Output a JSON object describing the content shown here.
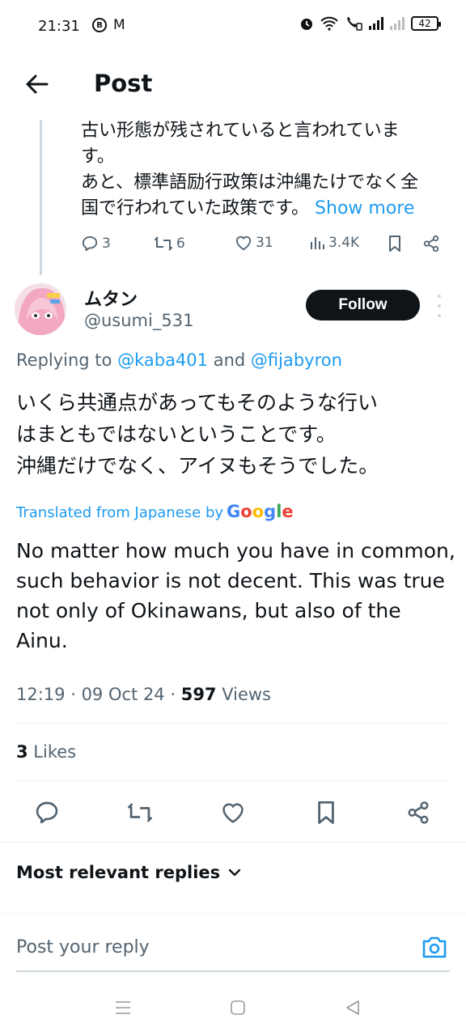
{
  "status_bar": {
    "time": "21:31",
    "left_icons": [
      "b-circle-icon",
      "gmail-icon"
    ],
    "right_icons": [
      "alarm-icon",
      "wifi-icon",
      "volte-call-icon",
      "signal-icon",
      "signal-weak-icon"
    ],
    "battery": "42"
  },
  "header": {
    "title": "Post"
  },
  "parent": {
    "text_line1": "古い形態が残されていると言われていま",
    "text_line2": "す。",
    "text_line3": "あと、標準語励行政策は沖縄たけでなく全",
    "text_line4": "国で行われていた政策です。",
    "show_more": "Show more",
    "replies": "3",
    "reposts": "6",
    "likes": "31",
    "views": "3.4K"
  },
  "reply": {
    "name": "ムタン",
    "handle": "@usumi_531",
    "follow_label": "Follow",
    "replying_prefix": "Replying to ",
    "replying_user1": "@kaba401",
    "replying_and": " and ",
    "replying_user2": "@fijabyron",
    "text_line1": "いくら共通点があってもそのような行い",
    "text_line2": "はまともではないということです。",
    "text_line3": "沖縄だけでなく、アイヌもそうでした。",
    "translated_label": "Translated from Japanese by",
    "translated_provider": "Google",
    "translation": "No matter how much you have in common, such behavior is not decent. This was true not only of Okinawans, but also of the Ainu.",
    "time": "12:19",
    "date": "09 Oct 24",
    "views_count": "597",
    "views_label": " Views",
    "likes_count": "3",
    "likes_label": " Likes"
  },
  "replies_section": {
    "sort_label": "Most relevant replies",
    "input_placeholder": "Post your reply"
  },
  "colors": {
    "accent": "#1d9bf0",
    "text": "#0f1419",
    "secondary": "#536471"
  }
}
